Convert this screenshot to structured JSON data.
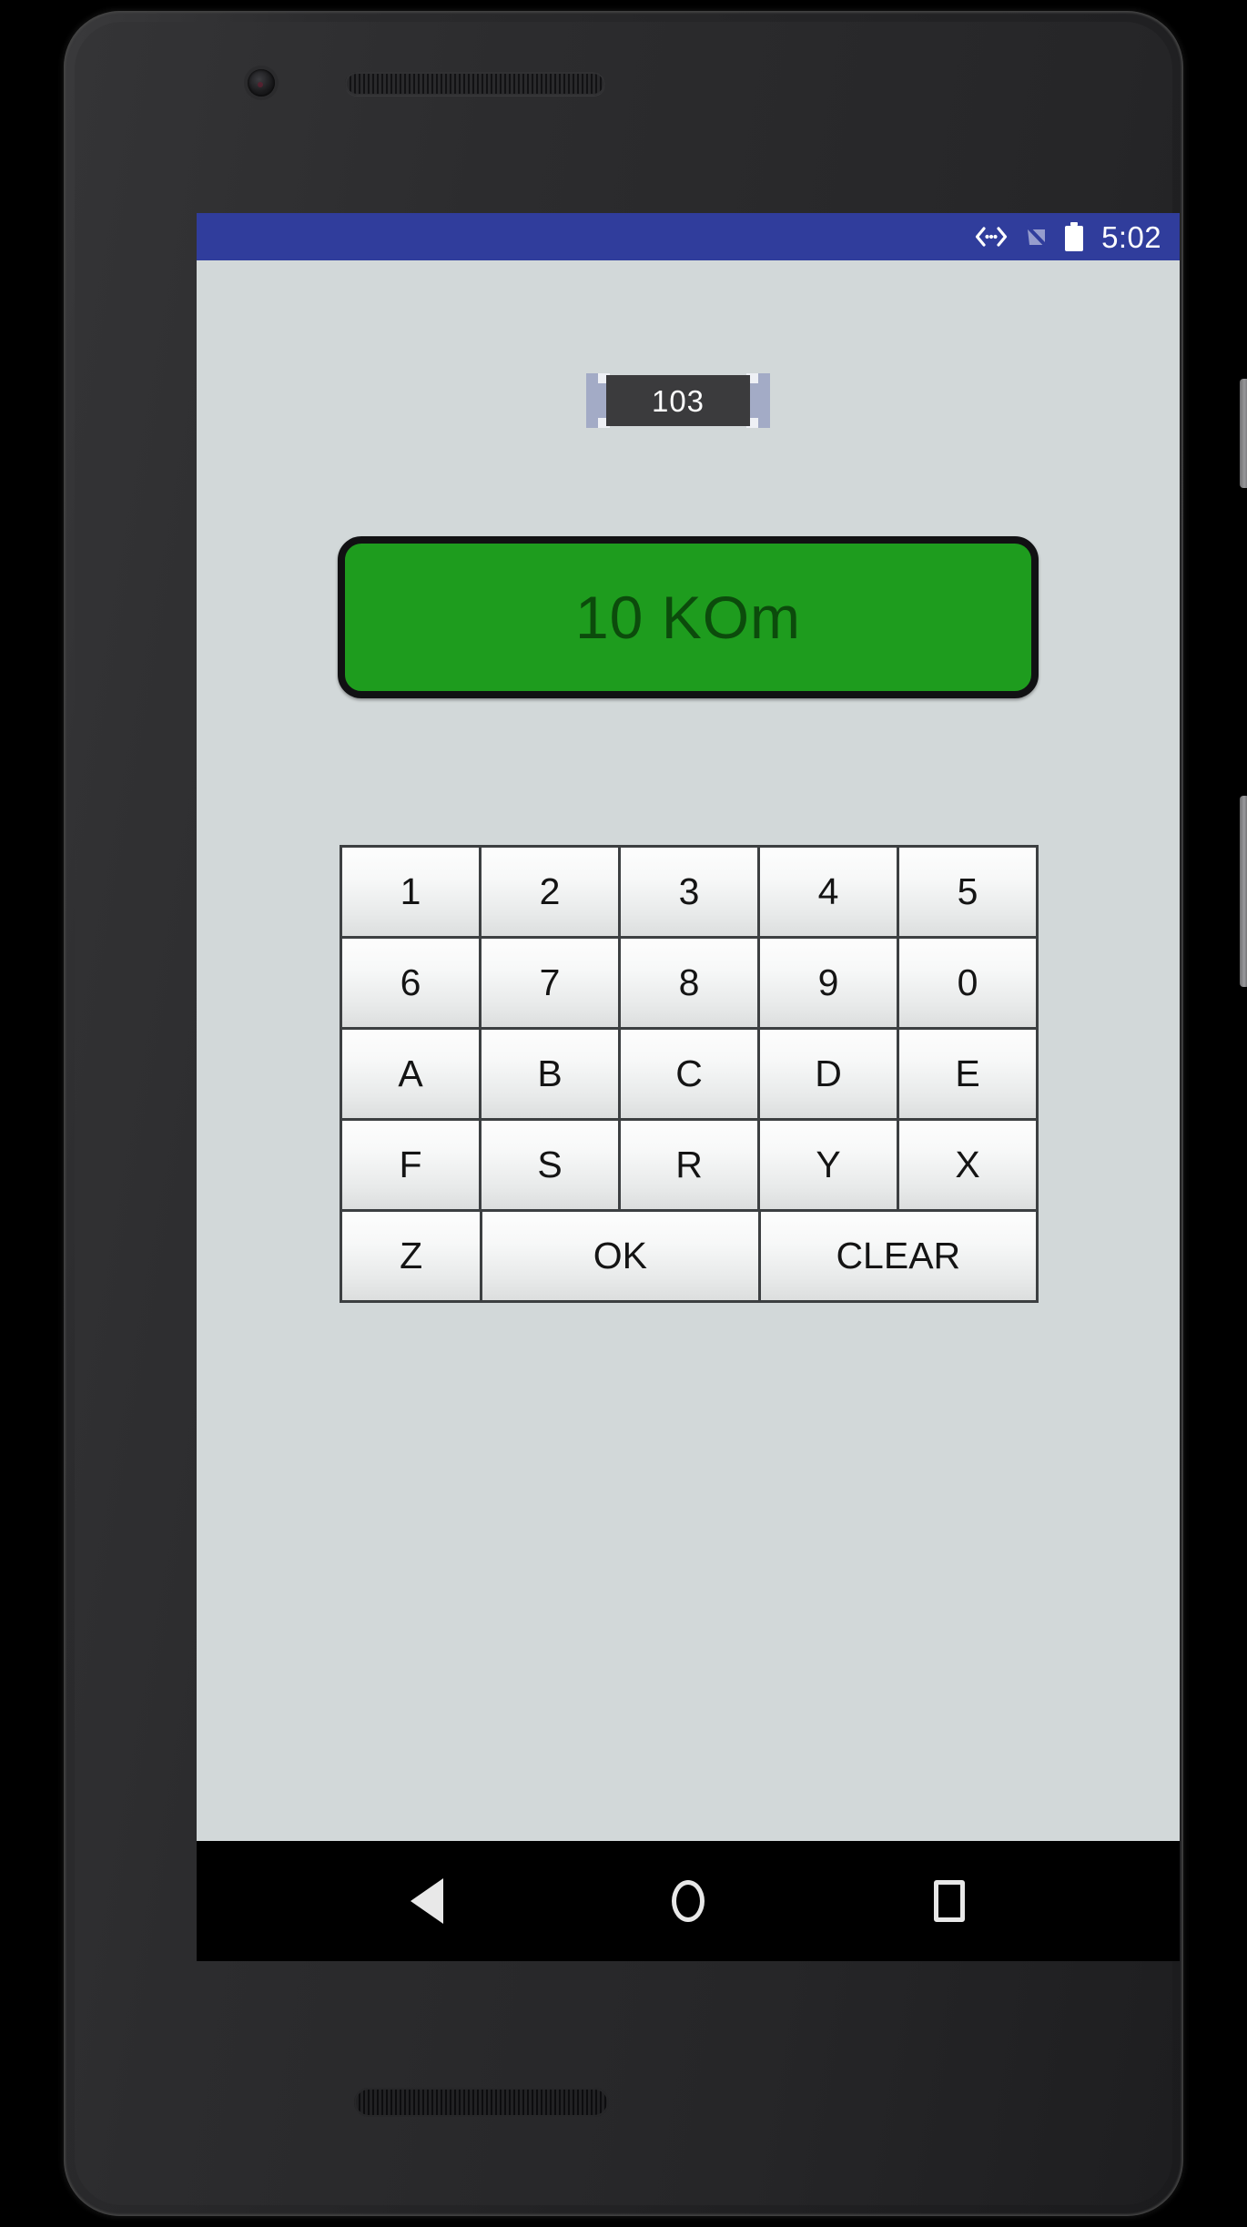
{
  "device": {
    "front_camera": "front-camera",
    "earpiece": "earpiece-speaker",
    "bottom_speaker": "bottom-speaker-grille",
    "power_button": "power-button",
    "volume_button": "volume-rocker-button"
  },
  "status_bar": {
    "background_color": "#303D9C",
    "time": "5:02",
    "icons": [
      {
        "name": "usb-debug-icon",
        "glyph": "<···>"
      },
      {
        "name": "notifications-muted-icon",
        "glyph": "muted"
      },
      {
        "name": "battery-full-icon",
        "glyph": "battery"
      }
    ]
  },
  "app": {
    "background_color": "#D2D8D9",
    "resistor": {
      "code": "103",
      "body_color": "#3B3B3D",
      "cap_color": "#A3ABC6"
    },
    "result_display": {
      "value": "10 KOm",
      "background_color": "#1E9C1E",
      "text_color": "#0C4B0C",
      "border_color": "#111113"
    },
    "keypad": {
      "rows": [
        [
          {
            "label": "1",
            "span": 1
          },
          {
            "label": "2",
            "span": 1
          },
          {
            "label": "3",
            "span": 1
          },
          {
            "label": "4",
            "span": 1
          },
          {
            "label": "5",
            "span": 1
          }
        ],
        [
          {
            "label": "6",
            "span": 1
          },
          {
            "label": "7",
            "span": 1
          },
          {
            "label": "8",
            "span": 1
          },
          {
            "label": "9",
            "span": 1
          },
          {
            "label": "0",
            "span": 1
          }
        ],
        [
          {
            "label": "A",
            "span": 1
          },
          {
            "label": "B",
            "span": 1
          },
          {
            "label": "C",
            "span": 1
          },
          {
            "label": "D",
            "span": 1
          },
          {
            "label": "E",
            "span": 1
          }
        ],
        [
          {
            "label": "F",
            "span": 1
          },
          {
            "label": "S",
            "span": 1
          },
          {
            "label": "R",
            "span": 1
          },
          {
            "label": "Y",
            "span": 1
          },
          {
            "label": "X",
            "span": 1
          }
        ],
        [
          {
            "label": "Z",
            "span": 1
          },
          {
            "label": "OK",
            "span": 2
          },
          {
            "label": "CLEAR",
            "span": 2
          }
        ]
      ]
    }
  },
  "nav_bar": {
    "background_color": "#000000",
    "buttons": [
      {
        "name": "nav-back-button",
        "label": "Back"
      },
      {
        "name": "nav-home-button",
        "label": "Home"
      },
      {
        "name": "nav-recents-button",
        "label": "Recents"
      }
    ]
  }
}
